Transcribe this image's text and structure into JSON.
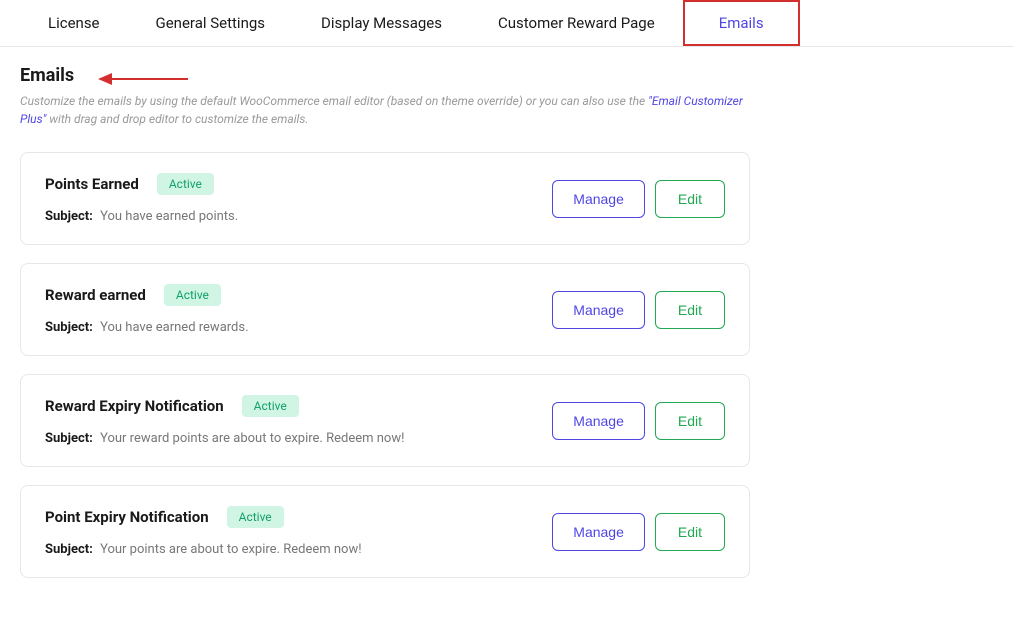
{
  "tabs": [
    {
      "label": "License"
    },
    {
      "label": "General Settings"
    },
    {
      "label": "Display Messages"
    },
    {
      "label": "Customer Reward Page"
    },
    {
      "label": "Emails",
      "active": true
    }
  ],
  "page": {
    "title": "Emails",
    "desc_before": "Customize the emails by using the default WooCommerce email editor (based on theme override) or you can also use the ",
    "desc_link": "\"Email Customizer Plus\"",
    "desc_after": " with drag and drop editor to customize the emails."
  },
  "labels": {
    "subject": "Subject:",
    "manage": "Manage",
    "edit": "Edit"
  },
  "emails": [
    {
      "title": "Points Earned",
      "status": "Active",
      "subject": "You have earned points."
    },
    {
      "title": "Reward earned",
      "status": "Active",
      "subject": "You have earned rewards."
    },
    {
      "title": "Reward Expiry Notification",
      "status": "Active",
      "subject": "Your reward points are about to expire. Redeem now!"
    },
    {
      "title": "Point Expiry Notification",
      "status": "Active",
      "subject": "Your points are about to expire. Redeem now!"
    }
  ]
}
